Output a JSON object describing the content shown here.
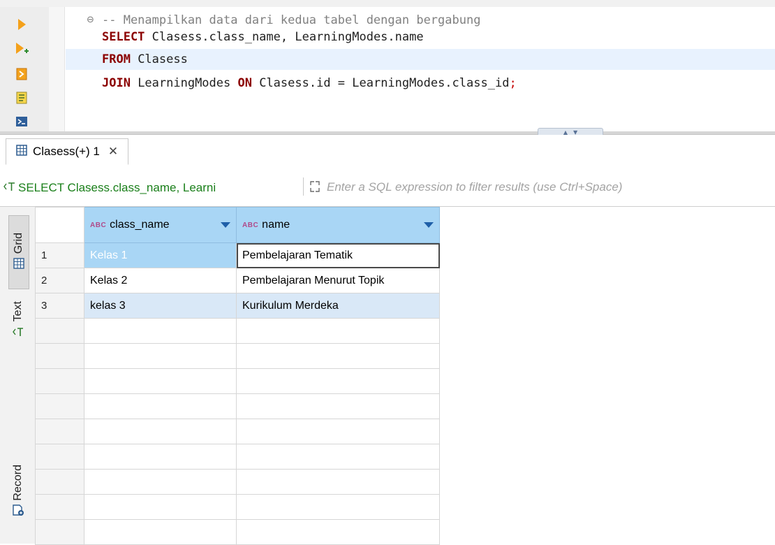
{
  "editor": {
    "lines": [
      {
        "parts": [
          {
            "t": "-- Menampilkan data dari kedua tabel dengan bergabung",
            "c": "cm"
          }
        ]
      },
      {
        "parts": [
          {
            "t": "SELECT",
            "c": "kw"
          },
          {
            "t": " Clasess.class_name, LearningModes.name",
            "c": ""
          }
        ]
      },
      {
        "parts": [
          {
            "t": "FROM",
            "c": "kw"
          },
          {
            "t": " Clasess",
            "c": ""
          }
        ]
      },
      {
        "parts": [
          {
            "t": "JOIN",
            "c": "kw"
          },
          {
            "t": " LearningModes ",
            "c": ""
          },
          {
            "t": "ON",
            "c": "kw"
          },
          {
            "t": " Clasess.id = LearningModes.class_id",
            "c": ""
          },
          {
            "t": ";",
            "c": "punct"
          }
        ]
      }
    ],
    "fold_marker": "⊖"
  },
  "results_tab": {
    "label": "Clasess(+) 1",
    "close": "✕"
  },
  "filter": {
    "query_text": "SELECT Clasess.class_name, Learni",
    "placeholder": "Enter a SQL expression to filter results (use Ctrl+Space)",
    "value": ""
  },
  "side_tabs": {
    "grid": "Grid",
    "text": "Text",
    "record": "Record"
  },
  "grid": {
    "type_badge": "ABC",
    "columns": [
      "class_name",
      "name"
    ],
    "rows": [
      {
        "num": "1",
        "class_name": "Kelas 1",
        "name": "Pembelajaran Tematik"
      },
      {
        "num": "2",
        "class_name": "Kelas 2",
        "name": "Pembelajaran Menurut Topik"
      },
      {
        "num": "3",
        "class_name": "kelas 3",
        "name": "Kurikulum Merdeka"
      }
    ]
  },
  "colors": {
    "keyword": "#8b0000",
    "comment": "#808080",
    "header_bg": "#a9d6f5",
    "selected_cell_bg": "#a9d6f5",
    "alt_row_bg": "#d9e8f7",
    "filter_query_text": "#1a7f1a"
  },
  "icons": {
    "toolbar": [
      "execute-statement-icon",
      "execute-statement-new-tab-icon",
      "execute-script-icon",
      "explain-plan-icon",
      "console-icon"
    ],
    "results_tab": "grid-table-icon",
    "filter": "sql-text-icon",
    "filter_expand": "expand-icon",
    "side_grid": "grid-icon",
    "side_text": "text-icon",
    "side_record": "record-icon",
    "column_sort": "sort-down-icon"
  }
}
